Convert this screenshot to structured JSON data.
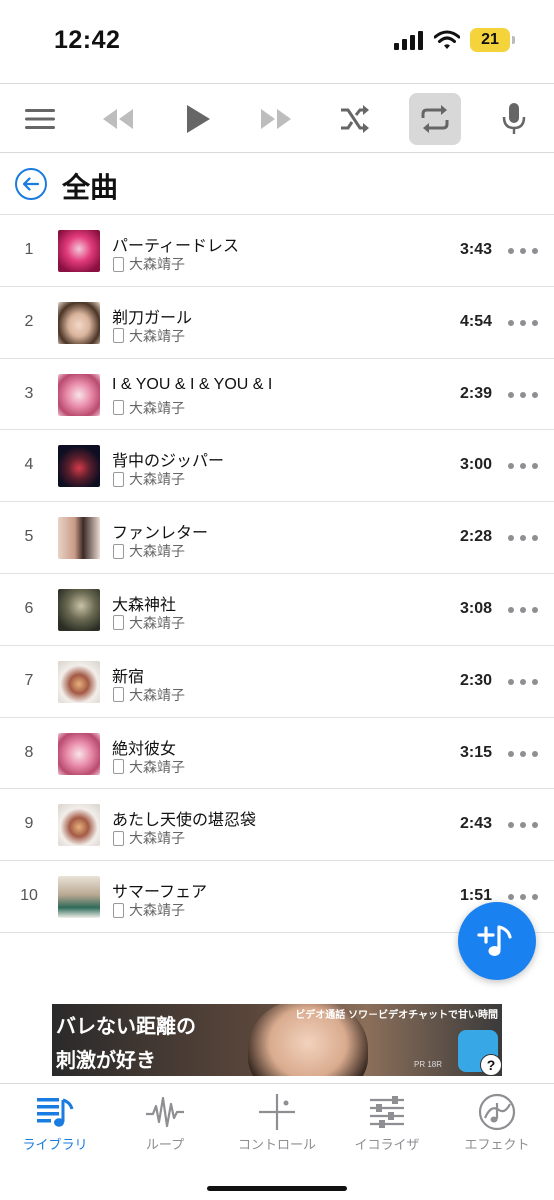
{
  "status_bar": {
    "time": "12:42",
    "battery": "21"
  },
  "toolbar": {
    "buttons": [
      "menu-icon",
      "rewind-icon",
      "play-icon",
      "fast-forward-icon",
      "shuffle-icon",
      "repeat-icon",
      "microphone-icon"
    ],
    "active": "repeat-icon"
  },
  "header": {
    "title": "全曲"
  },
  "songs": [
    {
      "num": "1",
      "title": "パーティードレス",
      "artist": "大森靖子",
      "duration": "3:43"
    },
    {
      "num": "2",
      "title": "剃刀ガール",
      "artist": "大森靖子",
      "duration": "4:54"
    },
    {
      "num": "3",
      "title": "I & YOU & I & YOU & I",
      "artist": "大森靖子",
      "duration": "2:39"
    },
    {
      "num": "4",
      "title": "背中のジッパー",
      "artist": "大森靖子",
      "duration": "3:00"
    },
    {
      "num": "5",
      "title": "ファンレター",
      "artist": "大森靖子",
      "duration": "2:28"
    },
    {
      "num": "6",
      "title": "大森神社",
      "artist": "大森靖子",
      "duration": "3:08"
    },
    {
      "num": "7",
      "title": "新宿",
      "artist": "大森靖子",
      "duration": "2:30"
    },
    {
      "num": "8",
      "title": "絶対彼女",
      "artist": "大森靖子",
      "duration": "3:15"
    },
    {
      "num": "9",
      "title": "あたし天使の堪忍袋",
      "artist": "大森靖子",
      "duration": "2:43"
    },
    {
      "num": "10",
      "title": "サマーフェア",
      "artist": "大森靖子",
      "duration": "1:51"
    }
  ],
  "ad": {
    "headline1": "バレない距離の",
    "headline2": "刺激が好き",
    "top_text": "ビデオ通話 ソワ－ビデオチャットで甘い時間",
    "pr": "PR 18R"
  },
  "tabs": [
    {
      "label": "ライブラリ",
      "icon": "library-icon"
    },
    {
      "label": "ループ",
      "icon": "waveform-icon"
    },
    {
      "label": "コントロール",
      "icon": "crosshair-icon"
    },
    {
      "label": "イコライザ",
      "icon": "equalizer-icon"
    },
    {
      "label": "エフェクト",
      "icon": "effect-icon"
    }
  ],
  "colors": {
    "accent": "#1a7be0",
    "fab": "#1a82f0",
    "battery": "#f5d33b",
    "icon_gray": "#8e8e93"
  }
}
